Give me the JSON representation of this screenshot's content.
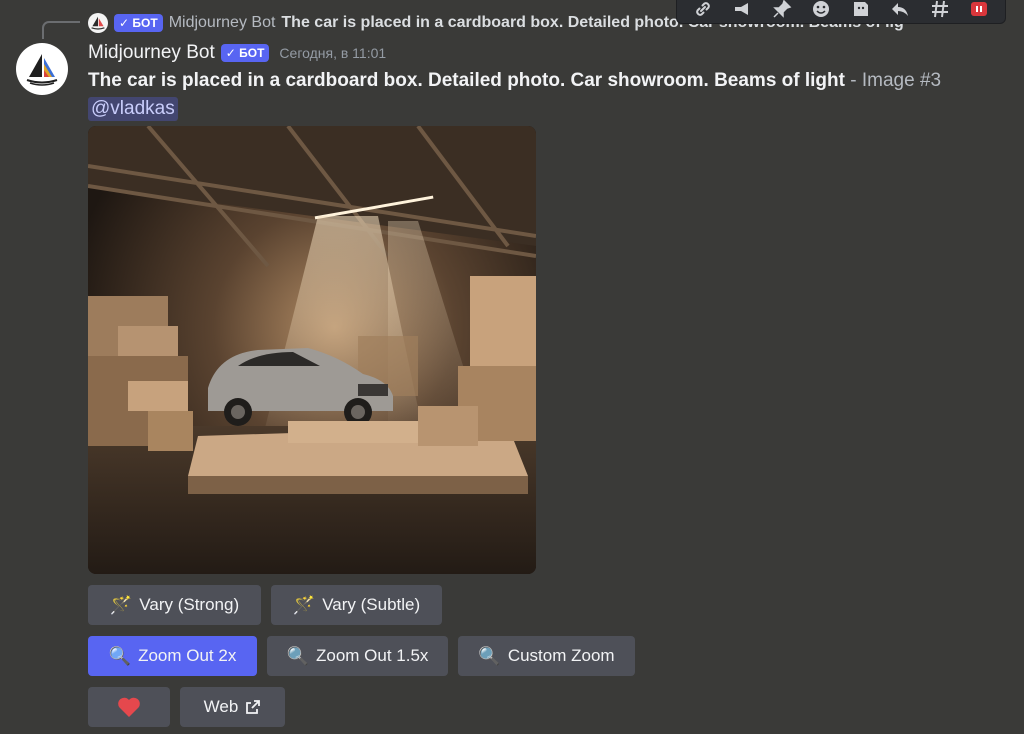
{
  "reply": {
    "author": "Midjourney Bot",
    "badge": "✓ БОТ",
    "text": "The car is placed in a cardboard box. Detailed photo. Car showroom. Beams of lig"
  },
  "message": {
    "author": "Midjourney Bot",
    "badge": "✓ БОТ",
    "timestamp": "Сегодня, в 11:01",
    "prompt": "The car is placed in a cardboard box. Detailed photo. Car showroom. Beams of light",
    "separator": " - ",
    "image_label": "Image #3",
    "mention": "@vladkas"
  },
  "toolbar_icons": [
    "link-icon",
    "megaphone-icon",
    "pin-icon",
    "emoji-icon",
    "sticker-icon",
    "reply-icon",
    "thread-icon",
    "delete-icon"
  ],
  "buttons": {
    "vary_strong": "Vary (Strong)",
    "vary_subtle": "Vary (Subtle)",
    "zoom_out_2x": "Zoom Out 2x",
    "zoom_out_15x": "Zoom Out 1.5x",
    "custom_zoom": "Custom Zoom",
    "web": "Web"
  },
  "colors": {
    "background": "#3a3a38",
    "blurple": "#5865f2",
    "button": "#4e5058",
    "heart": "#e5484d"
  }
}
